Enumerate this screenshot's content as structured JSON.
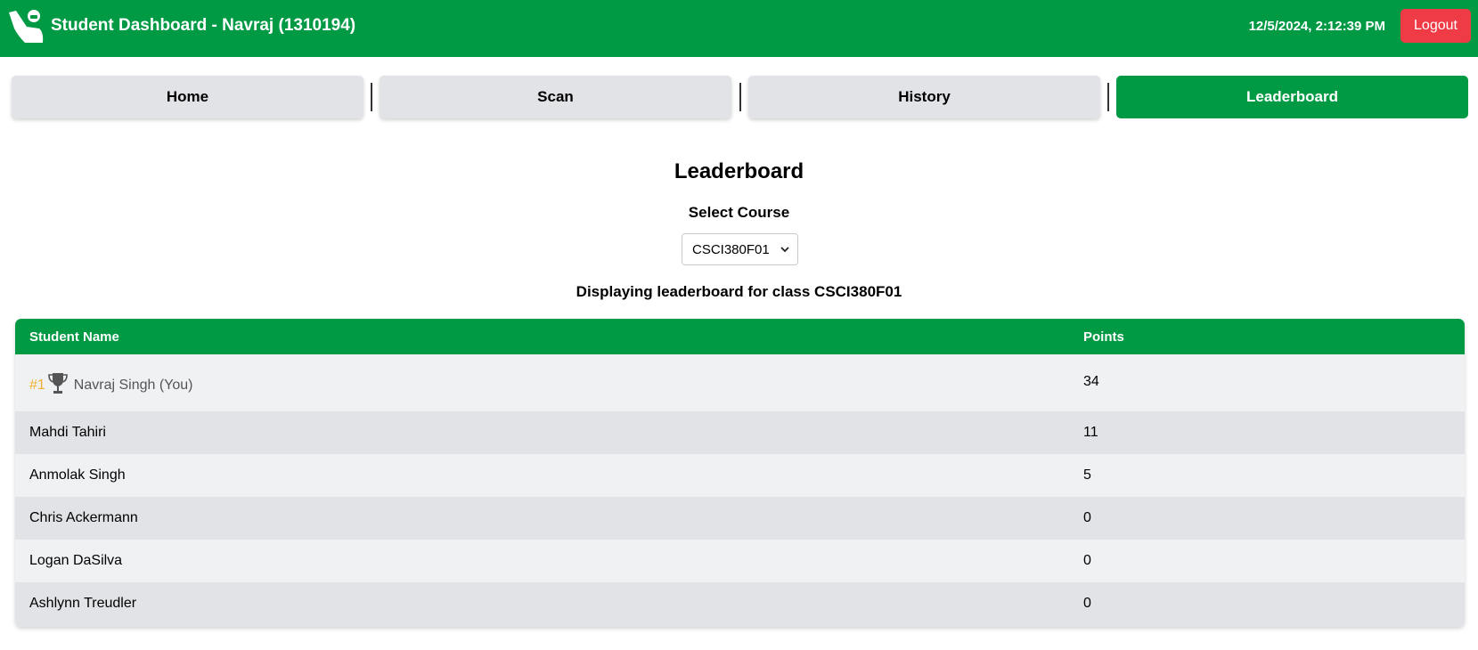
{
  "header": {
    "title": "Student Dashboard - Navraj (1310194)",
    "datetime": "12/5/2024, 2:12:39 PM",
    "logout_label": "Logout",
    "brand_color": "#009a44",
    "logout_color": "#ef3b45"
  },
  "nav": {
    "tabs": [
      {
        "label": "Home",
        "active": false
      },
      {
        "label": "Scan",
        "active": false
      },
      {
        "label": "History",
        "active": false
      },
      {
        "label": "Leaderboard",
        "active": true
      }
    ]
  },
  "leaderboard": {
    "title": "Leaderboard",
    "select_label": "Select Course",
    "selected_course": "CSCI380F01",
    "display_text": "Displaying leaderboard for class CSCI380F01",
    "columns": [
      "Student Name",
      "Points"
    ],
    "rows": [
      {
        "rank": "#1",
        "icon": "trophy-icon",
        "name": "Navraj Singh (You)",
        "points": "34"
      },
      {
        "name": "Mahdi Tahiri",
        "points": "11"
      },
      {
        "name": "Anmolak Singh",
        "points": "5"
      },
      {
        "name": "Chris Ackermann",
        "points": "0"
      },
      {
        "name": "Logan DaSilva",
        "points": "0"
      },
      {
        "name": "Ashlynn Treudler",
        "points": "0"
      }
    ]
  }
}
